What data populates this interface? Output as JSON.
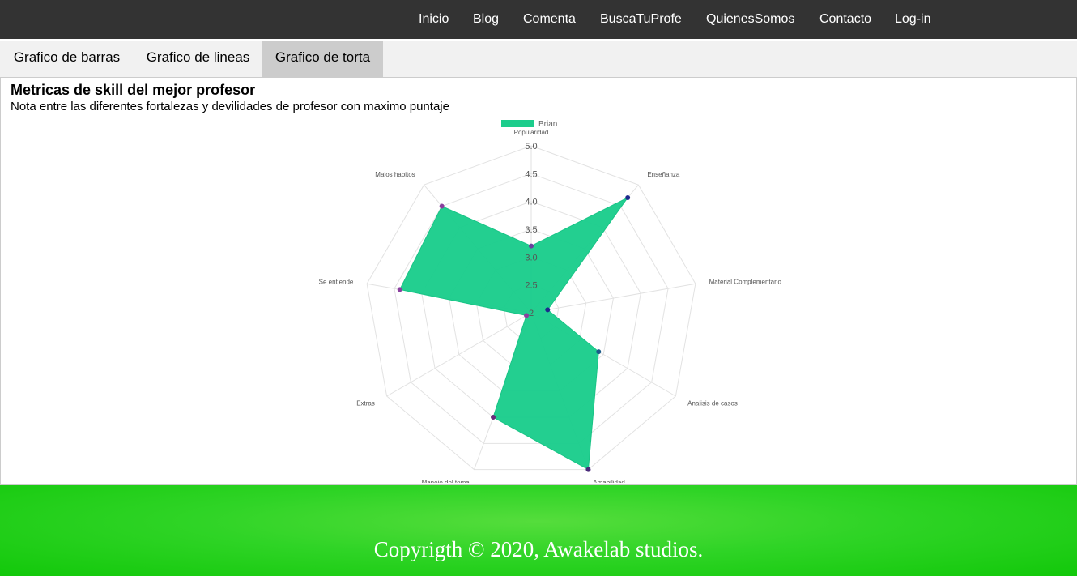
{
  "nav": {
    "items": [
      {
        "label": "Inicio"
      },
      {
        "label": "Blog"
      },
      {
        "label": "Comenta"
      },
      {
        "label": "BuscaTuProfe"
      },
      {
        "label": "QuienesSomos"
      },
      {
        "label": "Contacto"
      },
      {
        "label": "Log-in"
      }
    ]
  },
  "tabs": [
    {
      "label": "Grafico de barras",
      "active": false
    },
    {
      "label": "Grafico de lineas",
      "active": false
    },
    {
      "label": "Grafico de torta",
      "active": true
    }
  ],
  "panel": {
    "title": "Metricas de skill del mejor profesor",
    "subtitle": "Nota entre las diferentes fortalezas y devilidades de profesor con maximo puntaje"
  },
  "chart_data": {
    "type": "radar",
    "categories": [
      "Popularidad",
      "Enseñanza",
      "Material Complementario",
      "Analisis de casos",
      "Amabilidad",
      "Manejo del tema",
      "Extras",
      "Se entiende",
      "Malos habitos"
    ],
    "series": [
      {
        "name": "Brian",
        "values": [
          3.2,
          4.7,
          2.3,
          3.4,
          5.0,
          4.0,
          2.1,
          4.4,
          4.5
        ],
        "color": "#1ccd8c"
      }
    ],
    "ticks": [
      "5.0",
      "4.5",
      "4.0",
      "3.5",
      "3.0",
      "2.5",
      "2"
    ],
    "rlim": [
      2,
      5
    ],
    "legend_position": "top"
  },
  "footer": {
    "text": "Copyrigth © 2020, Awakelab studios."
  }
}
